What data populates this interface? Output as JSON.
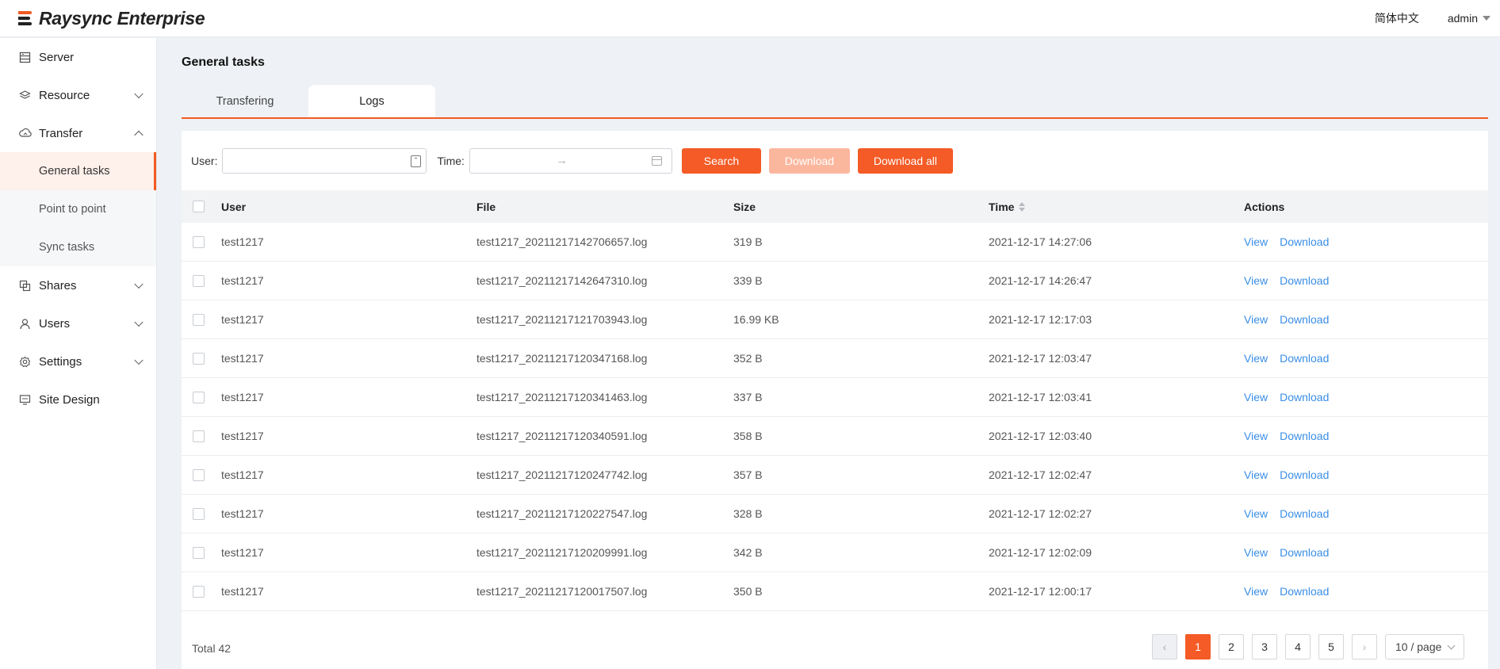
{
  "app": {
    "name": "Raysync Enterprise"
  },
  "header": {
    "language": "简体中文",
    "user": "admin"
  },
  "sidebar": {
    "items": [
      {
        "label": "Server",
        "icon": "server-icon"
      },
      {
        "label": "Resource",
        "icon": "layers-icon"
      },
      {
        "label": "Transfer",
        "icon": "cloud-transfer-icon"
      },
      {
        "label": "General tasks"
      },
      {
        "label": "Point to point"
      },
      {
        "label": "Sync tasks"
      },
      {
        "label": "Shares",
        "icon": "shares-icon"
      },
      {
        "label": "Users",
        "icon": "user-icon"
      },
      {
        "label": "Settings",
        "icon": "gear-icon"
      },
      {
        "label": "Site Design",
        "icon": "monitor-icon"
      }
    ]
  },
  "page": {
    "title": "General tasks"
  },
  "tabs": [
    {
      "label": "Transfering"
    },
    {
      "label": "Logs"
    }
  ],
  "filters": {
    "user_label": "User",
    "time_label": "Time",
    "user_value": "",
    "time_separator": "→",
    "search_label": "Search",
    "download_label": "Download",
    "download_all_label": "Download all"
  },
  "table": {
    "headers": {
      "user": "User",
      "file": "File",
      "size": "Size",
      "time": "Time",
      "actions": "Actions"
    },
    "rows": [
      {
        "user": "test1217",
        "file": "test1217_20211217142706657.log",
        "size": "319 B",
        "time": "2021-12-17 14:27:06"
      },
      {
        "user": "test1217",
        "file": "test1217_20211217142647310.log",
        "size": "339 B",
        "time": "2021-12-17 14:26:47"
      },
      {
        "user": "test1217",
        "file": "test1217_20211217121703943.log",
        "size": "16.99 KB",
        "time": "2021-12-17 12:17:03"
      },
      {
        "user": "test1217",
        "file": "test1217_20211217120347168.log",
        "size": "352 B",
        "time": "2021-12-17 12:03:47"
      },
      {
        "user": "test1217",
        "file": "test1217_20211217120341463.log",
        "size": "337 B",
        "time": "2021-12-17 12:03:41"
      },
      {
        "user": "test1217",
        "file": "test1217_20211217120340591.log",
        "size": "358 B",
        "time": "2021-12-17 12:03:40"
      },
      {
        "user": "test1217",
        "file": "test1217_20211217120247742.log",
        "size": "357 B",
        "time": "2021-12-17 12:02:47"
      },
      {
        "user": "test1217",
        "file": "test1217_20211217120227547.log",
        "size": "328 B",
        "time": "2021-12-17 12:02:27"
      },
      {
        "user": "test1217",
        "file": "test1217_20211217120209991.log",
        "size": "342 B",
        "time": "2021-12-17 12:02:09"
      },
      {
        "user": "test1217",
        "file": "test1217_20211217120017507.log",
        "size": "350 B",
        "time": "2021-12-17 12:00:17"
      }
    ],
    "actions": {
      "view": "View",
      "download": "Download"
    }
  },
  "pagination": {
    "total": "Total 42",
    "pages": [
      "1",
      "2",
      "3",
      "4",
      "5"
    ],
    "current": "1",
    "page_size": "10 / page",
    "prev_icon": "‹",
    "next_icon": "›"
  },
  "colors": {
    "accent": "#f45b26",
    "link": "#3a8ee6"
  }
}
